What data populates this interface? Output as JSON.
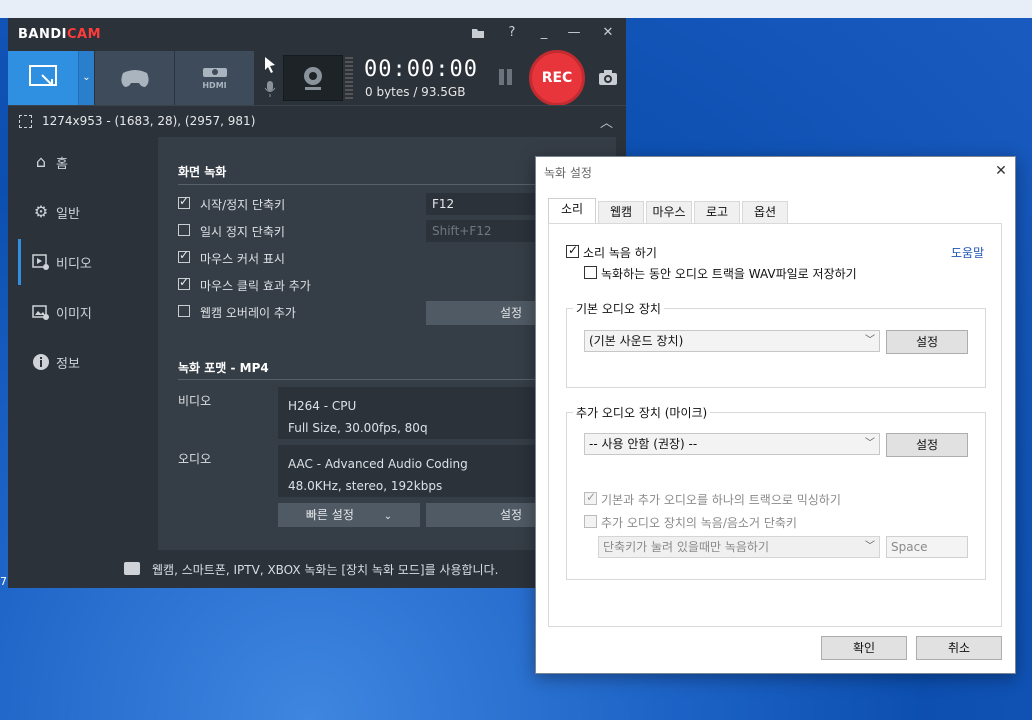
{
  "bandicam": {
    "logo_main": "BANDI",
    "logo_accent": "CAM",
    "titlebar_buttons": {
      "folder": "folder-icon",
      "help": "?",
      "min": "_",
      "max": "—",
      "close": "✕"
    },
    "toolbar": {
      "timer": "00:00:00",
      "bytes": "0 bytes / 93.5GB",
      "rec_label": "REC",
      "hdmi_label": "HDMI"
    },
    "target": {
      "text": "1274x953 - (1683, 28), (2957, 981)"
    },
    "sidebar": {
      "items": [
        {
          "label": "홈",
          "icon": "home-icon"
        },
        {
          "label": "일반",
          "icon": "gear-icon"
        },
        {
          "label": "비디오",
          "icon": "video-icon"
        },
        {
          "label": "이미지",
          "icon": "image-icon"
        },
        {
          "label": "정보",
          "icon": "info-icon"
        }
      ],
      "active_index": 2
    },
    "video": {
      "section_title": "화면 녹화",
      "options": [
        {
          "label": "시작/정지 단축키",
          "checked": true
        },
        {
          "label": "일시 정지 단축키",
          "checked": false
        },
        {
          "label": "마우스 커서 표시",
          "checked": true
        },
        {
          "label": "마우스 클릭 효과 추가",
          "checked": true
        },
        {
          "label": "웹캠 오버레이 추가",
          "checked": false
        }
      ],
      "hotkey_start": "F12",
      "hotkey_pause": "Shift+F12",
      "webcam_settings_btn": "설정",
      "format_title": "녹화 포맷 - MP4",
      "video_label": "비디오",
      "video_line1": "H264 - CPU",
      "video_line2": "Full Size, 30.00fps, 80q",
      "audio_label": "오디오",
      "audio_line1": "AAC - Advanced Audio Coding",
      "audio_line2": "48.0KHz, stereo, 192kbps",
      "quick_settings_btn": "빠른 설정",
      "settings_btn": "설정"
    },
    "footer": {
      "message": "웹캠, 스마트폰, IPTV, XBOX 녹화는 [장치 녹화 모드]를 사용합니다."
    }
  },
  "dialog": {
    "title": "녹화 설정",
    "close": "✕",
    "tabs": [
      "소리",
      "웹캠",
      "마우스",
      "로고",
      "옵션"
    ],
    "active_tab": 0,
    "record_sound": {
      "label": "소리 녹음 하기",
      "checked": true
    },
    "save_wav": {
      "label": "녹화하는 동안 오디오 트랙을 WAV파일로 저장하기",
      "checked": false
    },
    "help_link": "도움말",
    "primary_group": {
      "title": "기본 오디오 장치",
      "selected": "(기본 사운드 장치)",
      "settings_btn": "설정"
    },
    "secondary_group": {
      "title": "추가 오디오 장치 (마이크)",
      "selected": "-- 사용 안함 (권장) --",
      "settings_btn": "설정",
      "mix_option": {
        "label": "기본과 추가 오디오를 하나의 트랙으로 믹싱하기",
        "checked": true
      },
      "hotkey_option": {
        "label": "추가 오디오 장치의 녹음/음소거 단축키",
        "checked": false
      },
      "hotkey_mode": "단축키가 눌려 있을때만 녹음하기",
      "hotkey_key": "Space"
    },
    "ok_btn": "확인",
    "cancel_btn": "취소"
  },
  "desktop": {
    "edge_text": "7"
  }
}
